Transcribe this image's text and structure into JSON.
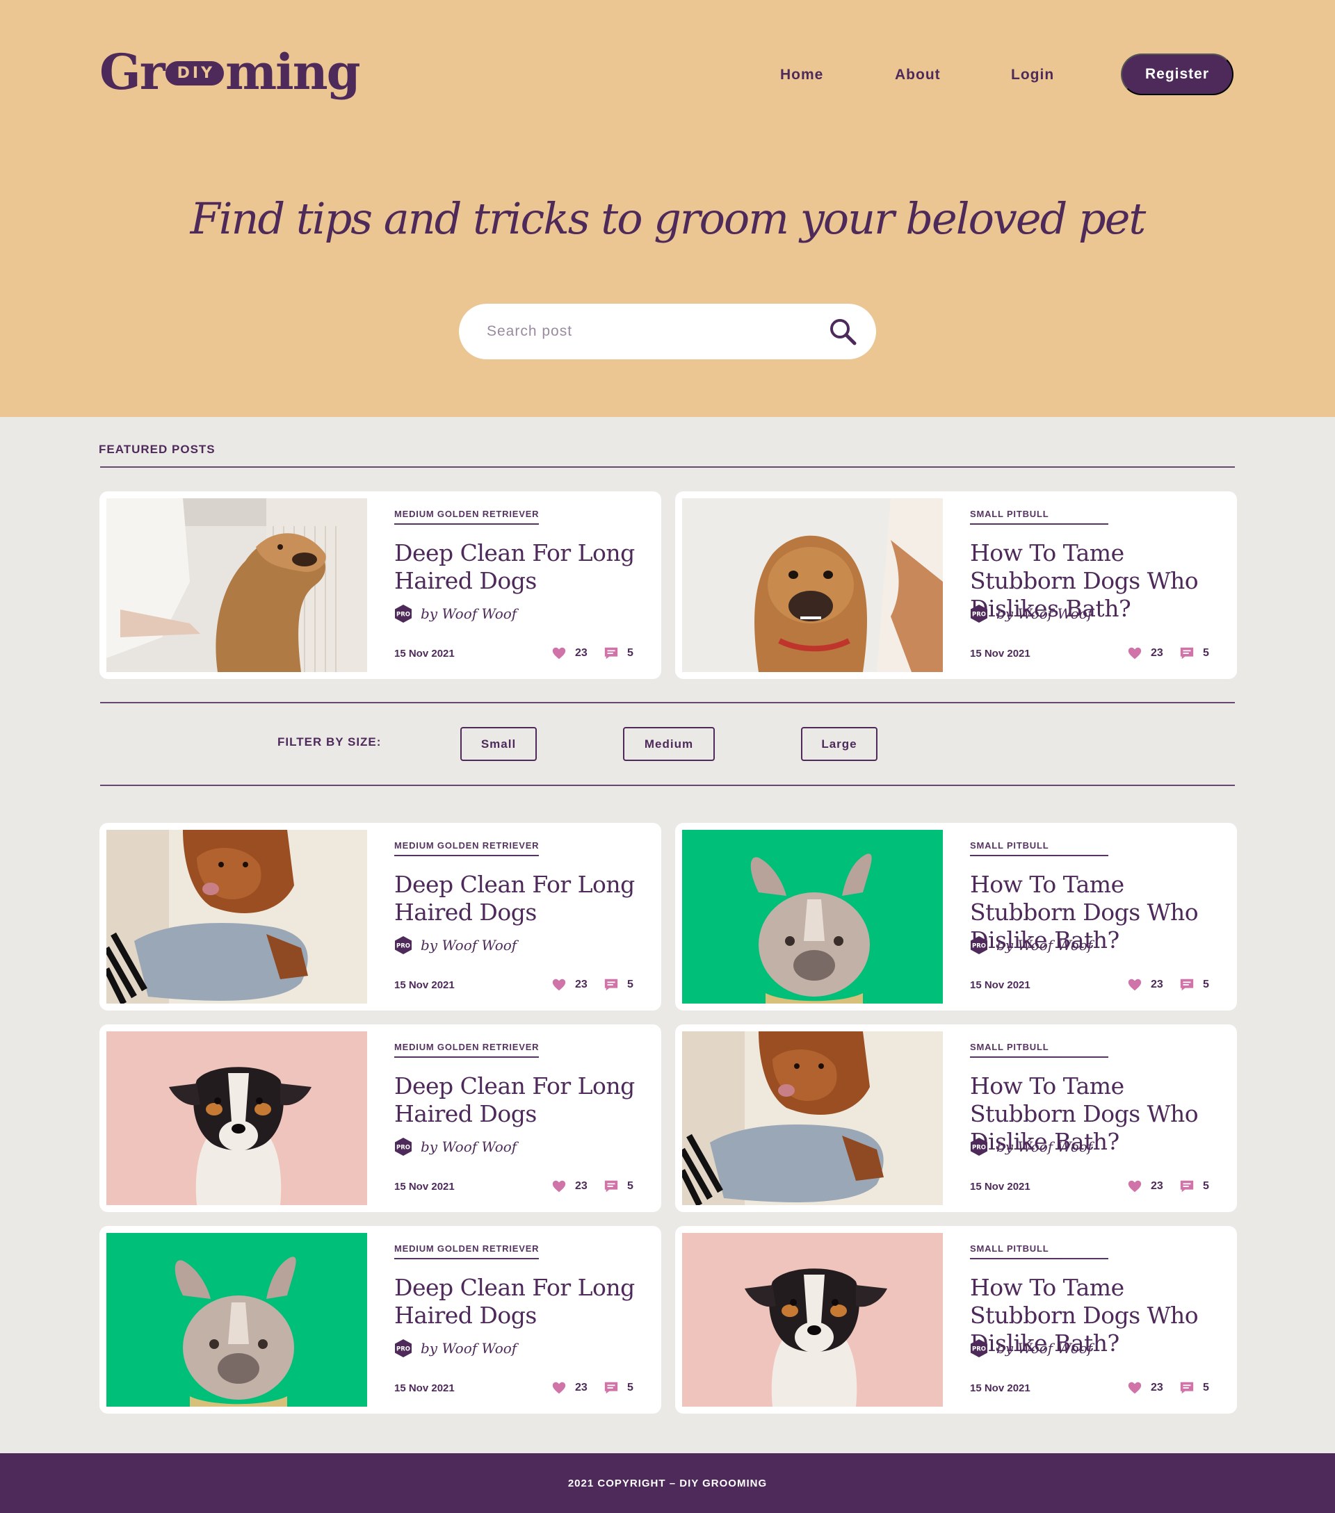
{
  "brand": {
    "logo_pre": "Gr",
    "logo_pill": "DIY",
    "logo_post": "ming"
  },
  "nav": {
    "home": "Home",
    "about": "About",
    "login": "Login",
    "register": "Register"
  },
  "hero": {
    "tagline": "Find tips and tricks to groom your beloved pet"
  },
  "search": {
    "placeholder": "Search post",
    "value": "",
    "icon": "search-icon"
  },
  "featured": {
    "label": "FEATURED POSTS",
    "posts": [
      {
        "category": "MEDIUM GOLDEN RETRIEVER",
        "title": "Deep Clean For Long Haired Dogs",
        "badge": "PRO",
        "author": "by Woof Woof",
        "date": "15 Nov 2021",
        "likes": "23",
        "comments": "5",
        "image": "golden-retriever-photo"
      },
      {
        "category": "SMALL PITBULL",
        "title": "How To Tame Stubborn Dogs Who Dislikes Bath?",
        "badge": "PRO",
        "author": "by Woof Woof",
        "date": "15 Nov 2021",
        "likes": "23",
        "comments": "5",
        "image": "bulldog-photo"
      }
    ]
  },
  "filter": {
    "label": "FILTER BY SIZE:",
    "options": [
      "Small",
      "Medium",
      "Large"
    ]
  },
  "posts": [
    {
      "category": "MEDIUM GOLDEN RETRIEVER",
      "title": "Deep Clean For Long Haired Dogs",
      "badge": "PRO",
      "author": "by Woof Woof",
      "date": "15 Nov 2021",
      "likes": "23",
      "comments": "5",
      "image": "brown-dog-towel-photo"
    },
    {
      "category": "SMALL PITBULL",
      "title": "How To Tame Stubborn Dogs Who Dislike Bath?",
      "badge": "PRO",
      "author": "by Woof Woof",
      "date": "15 Nov 2021",
      "likes": "23",
      "comments": "5",
      "image": "french-bulldog-green-photo"
    },
    {
      "category": "MEDIUM GOLDEN RETRIEVER",
      "title": "Deep Clean For Long Haired Dogs",
      "badge": "PRO",
      "author": "by Woof Woof",
      "date": "15 Nov 2021",
      "likes": "23",
      "comments": "5",
      "image": "terrier-pink-photo"
    },
    {
      "category": "SMALL PITBULL",
      "title": "How To Tame Stubborn Dogs Who Dislike Bath?",
      "badge": "PRO",
      "author": "by Woof Woof",
      "date": "15 Nov 2021",
      "likes": "23",
      "comments": "5",
      "image": "brown-dog-towel-photo"
    },
    {
      "category": "MEDIUM GOLDEN RETRIEVER",
      "title": "Deep Clean For Long Haired Dogs",
      "badge": "PRO",
      "author": "by Woof Woof",
      "date": "15 Nov 2021",
      "likes": "23",
      "comments": "5",
      "image": "french-bulldog-green-photo"
    },
    {
      "category": "SMALL PITBULL",
      "title": "How To Tame Stubborn Dogs Who Dislike Bath?",
      "badge": "PRO",
      "author": "by Woof Woof",
      "date": "15 Nov 2021",
      "likes": "23",
      "comments": "5",
      "image": "terrier-pink-photo"
    }
  ],
  "footer": {
    "copyright": "2021 COPYRIGHT – DIY GROOMING"
  },
  "colors": {
    "primary": "#4e2a5a",
    "hero_bg": "#ebc592",
    "page_bg": "#ebe9e5",
    "accent_pink": "#cf73a8",
    "green_photo": "#00bf78",
    "pink_photo": "#efc4bd"
  }
}
